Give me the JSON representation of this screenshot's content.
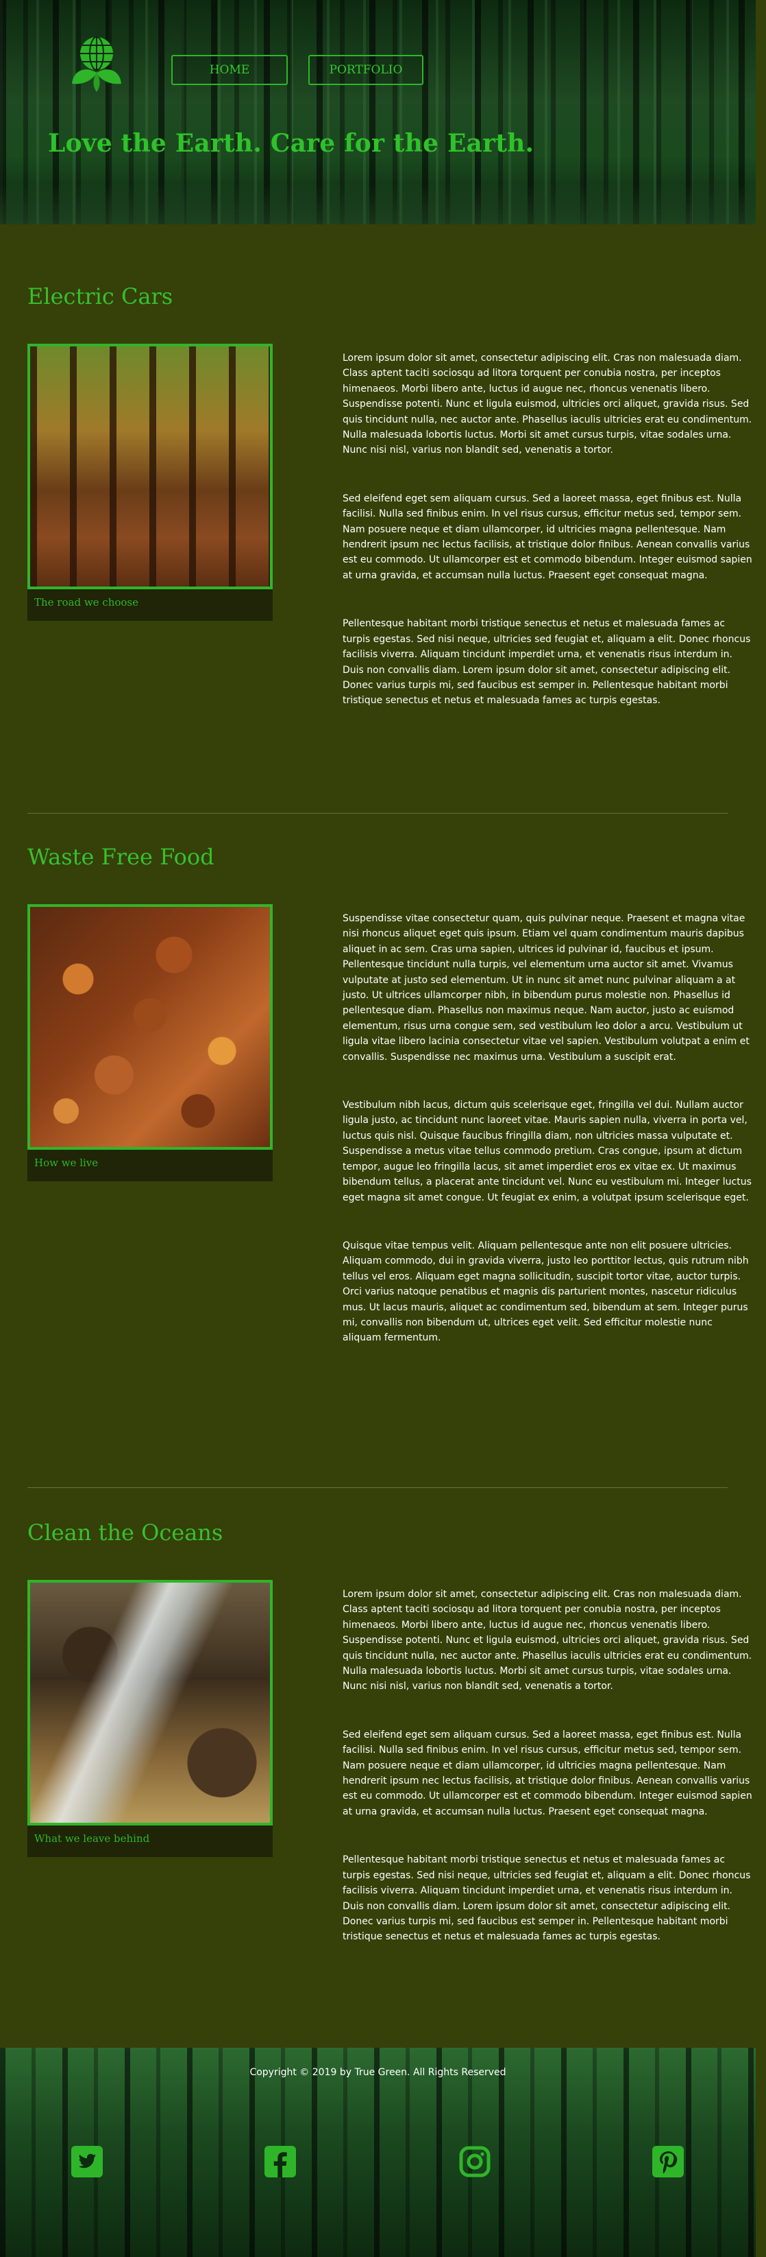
{
  "header": {
    "nav": [
      {
        "label": "HOME"
      },
      {
        "label": "PORTFOLIO"
      }
    ],
    "tagline": "Love the Earth. Care for the Earth."
  },
  "sections": [
    {
      "title": "Electric Cars",
      "caption": "The road we choose",
      "paragraphs": [
        "Lorem ipsum dolor sit amet, consectetur adipiscing elit. Cras non malesuada diam. Class aptent taciti sociosqu ad litora torquent per conubia nostra, per inceptos himenaeos. Morbi libero ante, luctus id augue nec, rhoncus venenatis libero. Suspendisse potenti. Nunc et ligula euismod, ultricies orci aliquet, gravida risus. Sed quis tincidunt nulla, nec auctor ante. Phasellus iaculis ultricies erat eu condimentum. Nulla malesuada lobortis luctus. Morbi sit amet cursus turpis, vitae sodales urna. Nunc nisi nisl, varius non blandit sed, venenatis a tortor.",
        "Sed eleifend eget sem aliquam cursus. Sed a laoreet massa, eget finibus est. Nulla facilisi. Nulla sed finibus enim. In vel risus cursus, efficitur metus sed, tempor sem. Nam posuere neque et diam ullamcorper, id ultricies magna pellentesque. Nam hendrerit ipsum nec lectus facilisis, at tristique dolor finibus. Aenean convallis varius est eu commodo. Ut ullamcorper est et commodo bibendum. Integer euismod sapien at urna gravida, et accumsan nulla luctus. Praesent eget consequat magna.",
        "Pellentesque habitant morbi tristique senectus et netus et malesuada fames ac turpis egestas. Sed nisi neque, ultricies sed feugiat et, aliquam a elit. Donec rhoncus facilisis viverra. Aliquam tincidunt imperdiet urna, et venenatis risus interdum in. Duis non convallis diam. Lorem ipsum dolor sit amet, consectetur adipiscing elit. Donec varius turpis mi, sed faucibus est semper in. Pellentesque habitant morbi tristique senectus et netus et malesuada fames ac turpis egestas."
      ]
    },
    {
      "title": "Waste Free Food",
      "caption": "How we live",
      "paragraphs": [
        "Suspendisse vitae consectetur quam, quis pulvinar neque. Praesent et magna vitae nisi rhoncus aliquet eget quis ipsum. Etiam vel quam condimentum mauris dapibus aliquet in ac sem. Cras urna sapien, ultrices id pulvinar id, faucibus et ipsum. Pellentesque tincidunt nulla turpis, vel elementum urna auctor sit amet. Vivamus vulputate at justo sed elementum. Ut in nunc sit amet nunc pulvinar aliquam a at justo. Ut ultrices ullamcorper nibh, in bibendum purus molestie non. Phasellus id pellentesque diam. Phasellus non maximus neque. Nam auctor, justo ac euismod elementum, risus urna congue sem, sed vestibulum leo dolor a arcu. Vestibulum ut ligula vitae libero lacinia consectetur vitae vel sapien. Vestibulum volutpat a enim et convallis. Suspendisse nec maximus urna. Vestibulum a suscipit erat.",
        "Vestibulum nibh lacus, dictum quis scelerisque eget, fringilla vel dui. Nullam auctor ligula justo, ac tincidunt nunc laoreet vitae. Mauris sapien nulla, viverra in porta vel, luctus quis nisl. Quisque faucibus fringilla diam, non ultricies massa vulputate et. Suspendisse a metus vitae tellus commodo pretium. Cras congue, ipsum at dictum tempor, augue leo fringilla lacus, sit amet imperdiet eros ex vitae ex. Ut maximus bibendum tellus, a placerat ante tincidunt vel. Nunc eu vestibulum mi. Integer luctus eget magna sit amet congue. Ut feugiat ex enim, a volutpat ipsum scelerisque eget.",
        "Quisque vitae tempus velit. Aliquam pellentesque ante non elit posuere ultricies. Aliquam commodo, dui in gravida viverra, justo leo porttitor lectus, quis rutrum nibh tellus vel eros. Aliquam eget magna sollicitudin, suscipit tortor vitae, auctor turpis. Orci varius natoque penatibus et magnis dis parturient montes, nascetur ridiculus mus. Ut lacus mauris, aliquet ac condimentum sed, bibendum at sem. Integer purus mi, convallis non bibendum ut, ultrices eget velit. Sed efficitur molestie nunc aliquam fermentum."
      ]
    },
    {
      "title": "Clean the Oceans",
      "caption": "What we leave behind",
      "paragraphs": [
        "Lorem ipsum dolor sit amet, consectetur adipiscing elit. Cras non malesuada diam. Class aptent taciti sociosqu ad litora torquent per conubia nostra, per inceptos himenaeos. Morbi libero ante, luctus id augue nec, rhoncus venenatis libero. Suspendisse potenti. Nunc et ligula euismod, ultricies orci aliquet, gravida risus. Sed quis tincidunt nulla, nec auctor ante. Phasellus iaculis ultricies erat eu condimentum. Nulla malesuada lobortis luctus. Morbi sit amet cursus turpis, vitae sodales urna. Nunc nisi nisl, varius non blandit sed, venenatis a tortor.",
        "Sed eleifend eget sem aliquam cursus. Sed a laoreet massa, eget finibus est. Nulla facilisi. Nulla sed finibus enim. In vel risus cursus, efficitur metus sed, tempor sem. Nam posuere neque et diam ullamcorper, id ultricies magna pellentesque. Nam hendrerit ipsum nec lectus facilisis, at tristique dolor finibus. Aenean convallis varius est eu commodo. Ut ullamcorper est et commodo bibendum. Integer euismod sapien at urna gravida, et accumsan nulla luctus. Praesent eget consequat magna.",
        "Pellentesque habitant morbi tristique senectus et netus et malesuada fames ac turpis egestas. Sed nisi neque, ultricies sed feugiat et, aliquam a elit. Donec rhoncus facilisis viverra. Aliquam tincidunt imperdiet urna, et venenatis risus interdum in. Duis non convallis diam. Lorem ipsum dolor sit amet, consectetur adipiscing elit. Donec varius turpis mi, sed faucibus est semper in. Pellentesque habitant morbi tristique senectus et netus et malesuada fames ac turpis egestas."
      ]
    }
  ],
  "footer": {
    "copyright": "Copyright © 2019 by True Green. All Rights Reserved",
    "social_icons": [
      "twitter-icon",
      "facebook-icon",
      "instagram-icon",
      "pinterest-icon"
    ]
  },
  "colors": {
    "background": "#364009",
    "accent_green": "#2fb52a",
    "text": "#ffffff",
    "caption_bg": "#1f2506"
  }
}
